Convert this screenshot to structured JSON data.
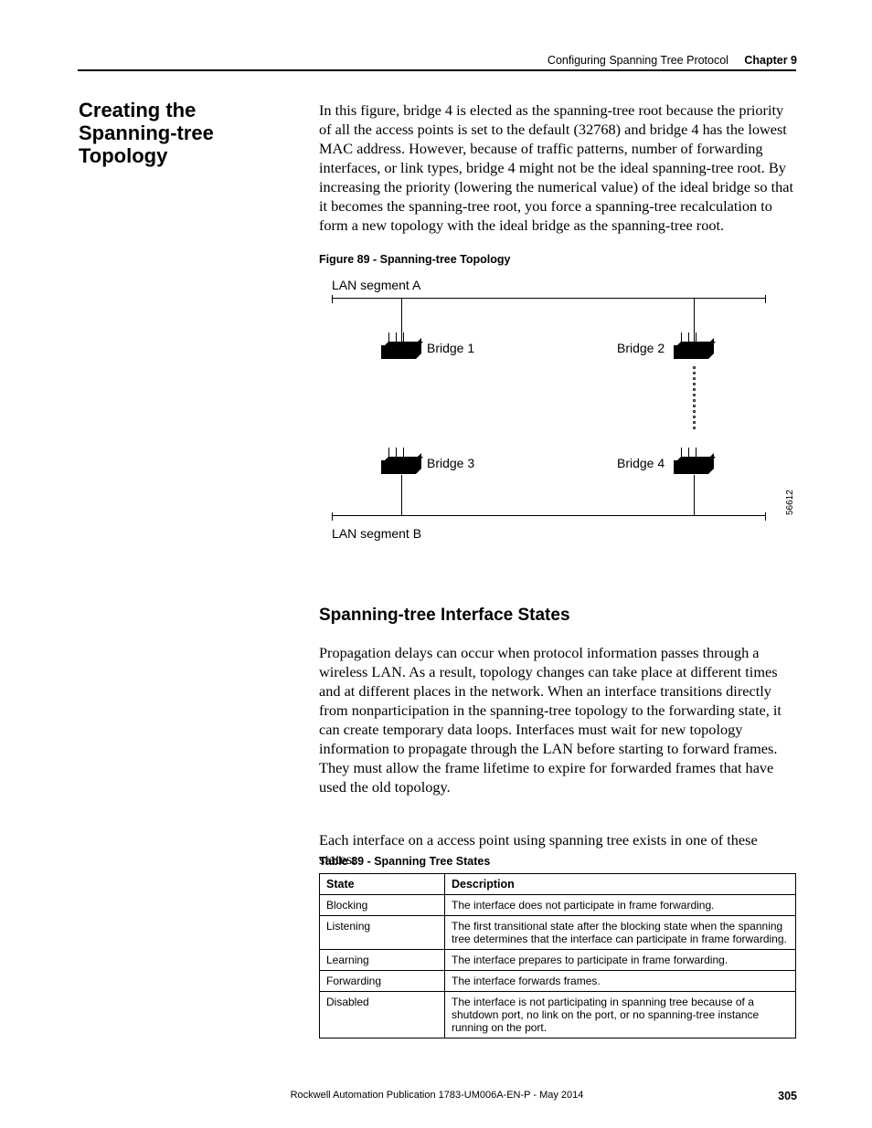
{
  "header": {
    "section": "Configuring Spanning Tree Protocol",
    "chapter_label": "Chapter 9"
  },
  "h1": "Creating the Spanning-tree Topology",
  "p1": "In this figure, bridge 4 is elected as the spanning-tree root because the priority of all the access points is set to the default (32768) and bridge 4 has the lowest MAC address. However, because of traffic patterns, number of forwarding interfaces, or link types, bridge 4 might not be the ideal spanning-tree root. By increasing the priority (lowering the numerical value) of the ideal bridge so that it becomes the spanning-tree root, you force a spanning-tree recalculation to form a new topology with the ideal bridge as the spanning-tree root.",
  "figure": {
    "caption": "Figure 89 - Spanning-tree Topology",
    "lanA": "LAN segment A",
    "lanB": "LAN segment B",
    "b1": "Bridge 1",
    "b2": "Bridge 2",
    "b3": "Bridge 3",
    "b4": "Bridge 4",
    "srcnum": "56612"
  },
  "h2": "Spanning-tree Interface States",
  "p2": "Propagation delays can occur when protocol information passes through a wireless LAN. As a result, topology changes can take place at different times and at different places in the network. When an interface transitions directly from nonparticipation in the spanning-tree topology to the forwarding state, it can create temporary data loops. Interfaces must wait for new topology information to propagate through the LAN before starting to forward frames. They must allow the frame lifetime to expire for forwarded frames that have used the old topology.",
  "p3": "Each interface on a access point using spanning tree exists in one of these states:",
  "table": {
    "caption": "Table 89 - Spanning Tree States",
    "h_state": "State",
    "h_desc": "Description",
    "rows": [
      {
        "state": "Blocking",
        "desc": "The interface does not participate in frame forwarding."
      },
      {
        "state": "Listening",
        "desc": "The first transitional state after the blocking state when the spanning tree determines that the interface can participate in frame forwarding."
      },
      {
        "state": "Learning",
        "desc": "The interface prepares to participate in frame forwarding."
      },
      {
        "state": "Forwarding",
        "desc": "The interface forwards frames."
      },
      {
        "state": "Disabled",
        "desc": "The interface is not participating in spanning tree because of a shutdown port, no link on the port, or no spanning-tree instance running on the port."
      }
    ]
  },
  "footer": "Rockwell Automation Publication 1783-UM006A-EN-P - May 2014",
  "page": "305"
}
